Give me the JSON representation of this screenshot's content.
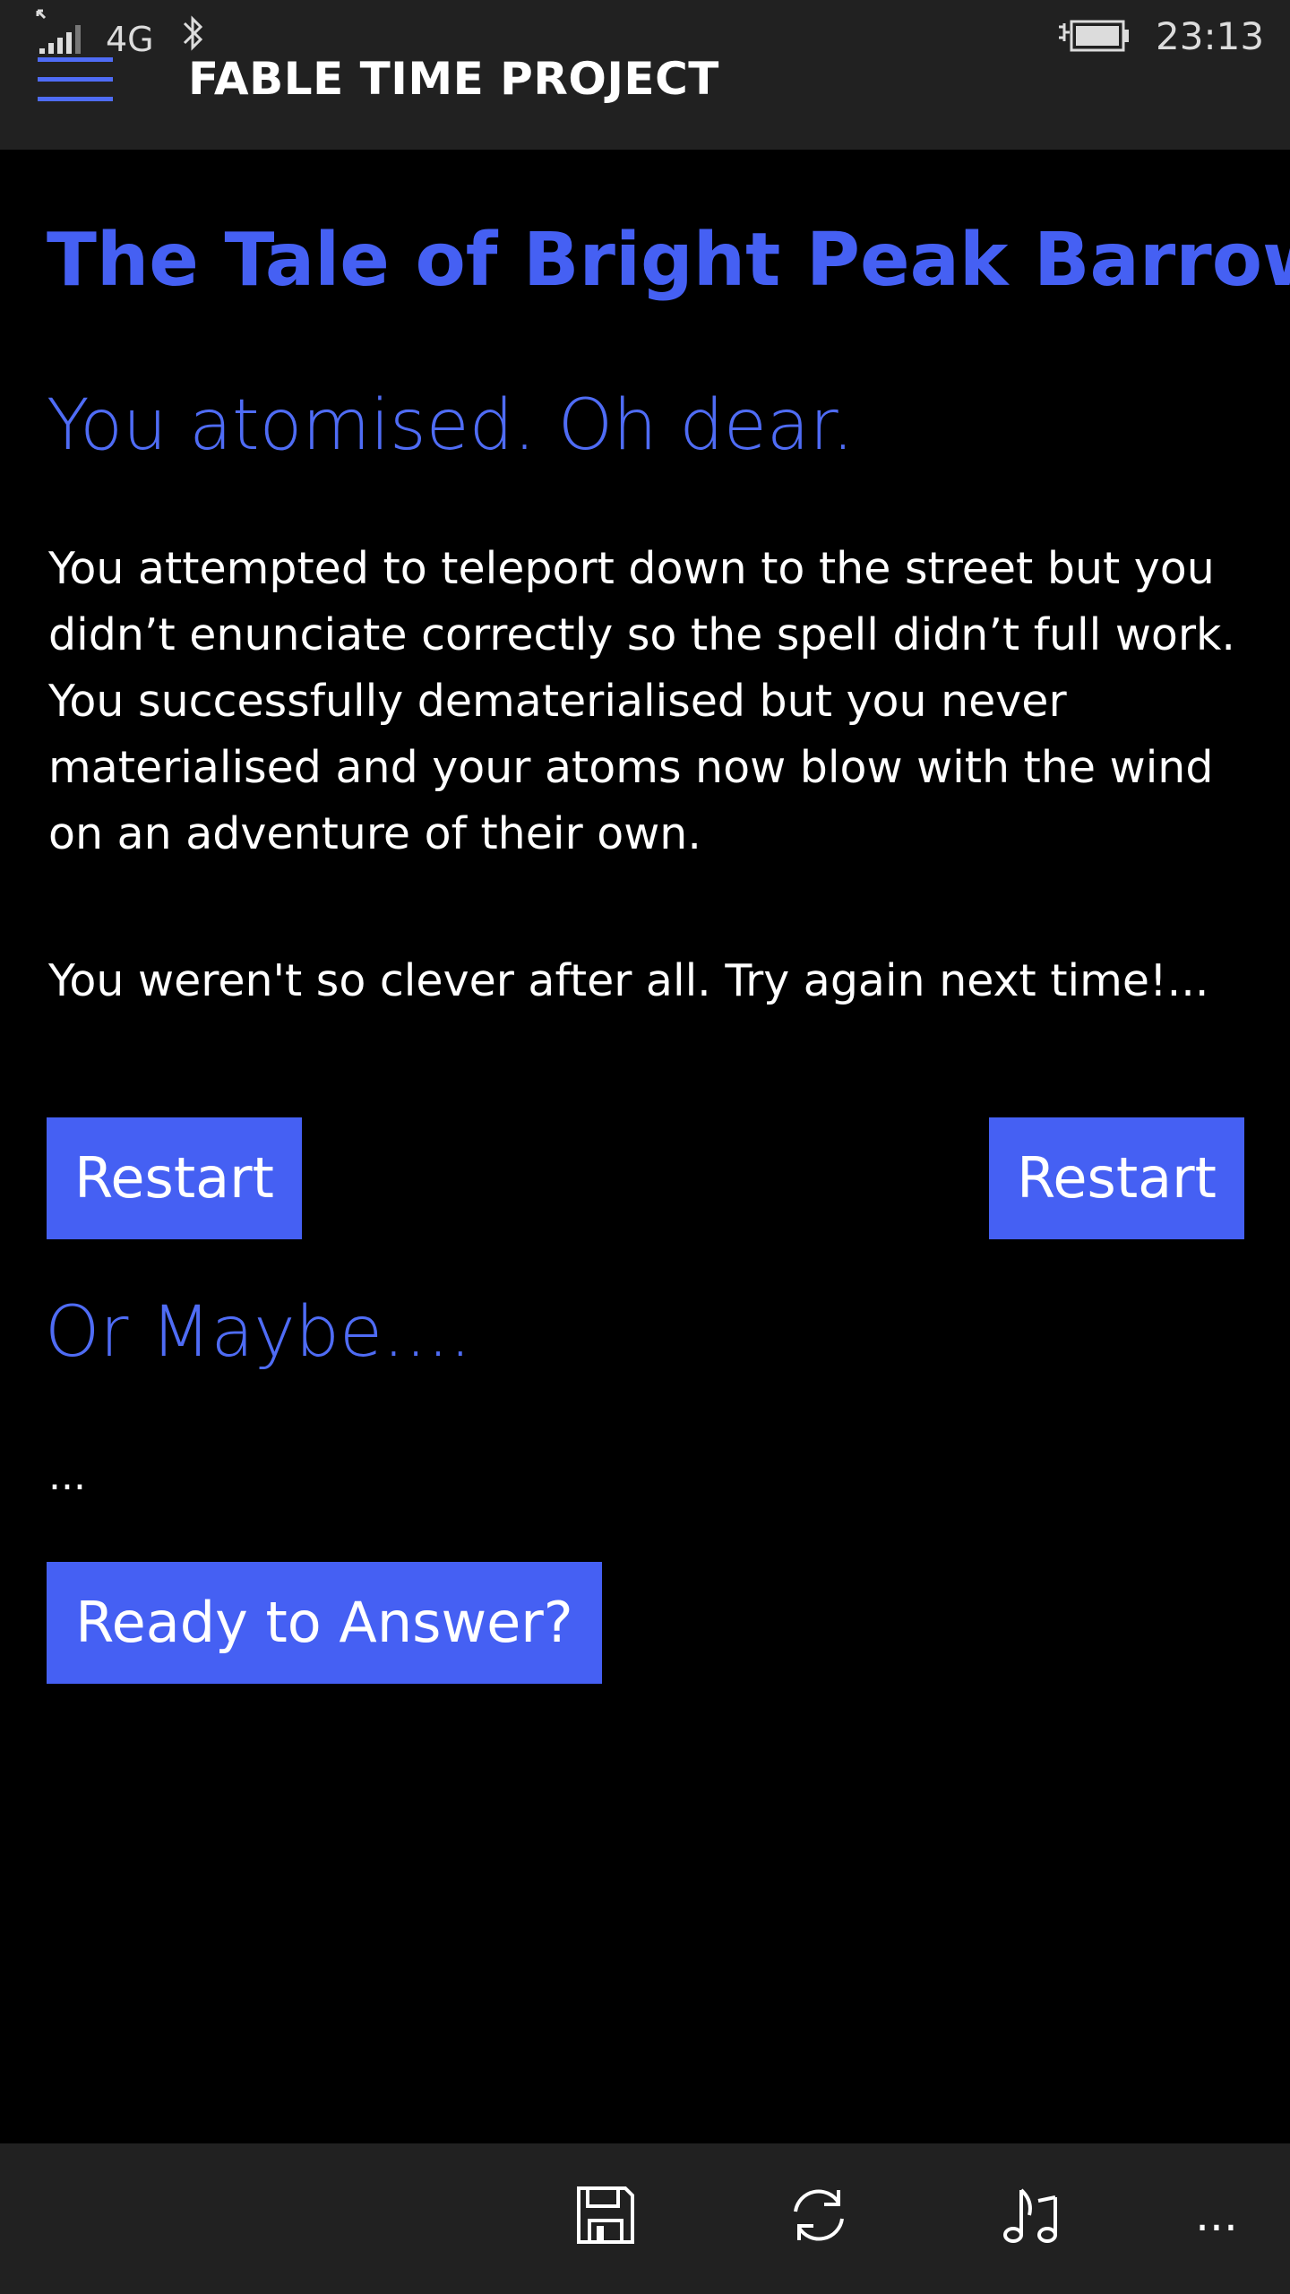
{
  "status_bar": {
    "network": "4G",
    "time": "23:13",
    "icons": [
      "signal-icon",
      "bluetooth-icon",
      "battery-charging-icon"
    ]
  },
  "header": {
    "menu_icon": "hamburger-icon",
    "title": "FABLE TIME PROJECT"
  },
  "story": {
    "title": "The Tale of Bright Peak Barrow",
    "outcome_heading": "You atomised. Oh dear.",
    "body": "You attempted to teleport down to the street but you didn’t enunciate correctly so the spell didn’t full work. You successfully dematerialised but you never materialised and your atoms now blow with the wind on an adventure of their own.",
    "closing": "You weren't so clever after all. Try again next time!..."
  },
  "actions": {
    "restart_left_label": "Restart",
    "restart_right_label": "Restart",
    "or_maybe_heading": "Or Maybe....",
    "ellipsis": "...",
    "ready_label": "Ready to Answer?"
  },
  "app_bar": {
    "buttons": [
      "save-icon",
      "refresh-icon",
      "music-icon"
    ],
    "more_label": "..."
  },
  "colors": {
    "accent": "#4560f3",
    "accent_light": "#4f6cf5",
    "bar_background": "#212121",
    "page_background": "#000000",
    "text": "#ffffff"
  }
}
